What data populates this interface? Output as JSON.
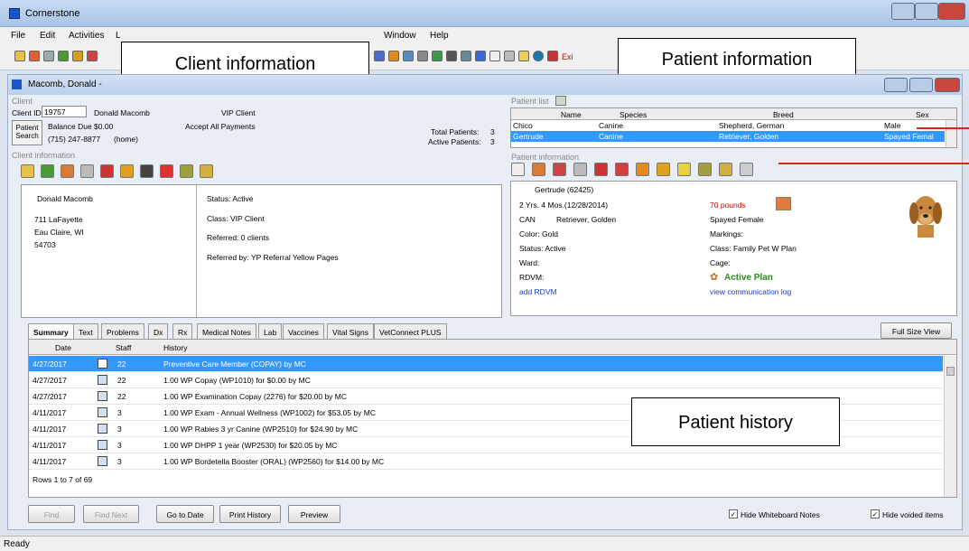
{
  "window": {
    "title": "Cornerstone",
    "status": "Ready"
  },
  "menu": [
    "File",
    "Edit",
    "Activities",
    "L",
    "Window",
    "Help"
  ],
  "toolbar": {
    "exit_label": "Exi"
  },
  "callouts": {
    "client": "Client information",
    "patient": "Patient information",
    "history": "Patient history"
  },
  "child": {
    "title": "Macomb, Donald -"
  },
  "client": {
    "section": "Client",
    "id_label": "Client ID:",
    "id_value": "19757",
    "name": "Donald Macomb",
    "vip": "VIP Client",
    "balance": "Balance Due  $0.00",
    "payments": "Accept All Payments",
    "search_line1": "Patient",
    "search_line2": "Search",
    "phone": "(715) 247-8877",
    "phone_type": "(home)",
    "total_label": "Total Patients:",
    "total_value": "3",
    "active_label": "Active Patients:",
    "active_value": "3",
    "info_section": "Client information",
    "name2": "Donald Macomb",
    "addr1": "711 LaFayette",
    "addr2": "Eau Claire, WI",
    "zip": "54703",
    "status": "Status:  Active",
    "class": "Class:   VIP Client",
    "referred": "Referred:   0 clients",
    "referred_by": "Referred by: YP  Referral Yellow Pages"
  },
  "patient_list": {
    "section": "Patient list",
    "headers": [
      "Name",
      "Species",
      "Breed",
      "Sex"
    ],
    "rows": [
      [
        "Chico",
        "Canine",
        "Shepherd, German",
        "Male"
      ],
      [
        "Gertrude",
        "Canine",
        "Retriever, Golden",
        "Spayed Femal"
      ]
    ]
  },
  "patient": {
    "section": "Patient information",
    "name": "Gertrude  (62425)",
    "age": "2 Yrs. 4 Mos.(12/28/2014)",
    "weight": "70 pounds",
    "species": "CAN",
    "breed": "Retriever, Golden",
    "sex": "Spayed Female",
    "color": "Color:  Gold",
    "markings": "Markings:",
    "status": "Status:  Active",
    "class": "Class:  Family Pet W Plan",
    "ward": "Ward:",
    "cage": "Cage:",
    "rdvm": "RDVM:",
    "plan": "Active Plan",
    "add_rdvm": "add RDVM",
    "comm_log": "view communication log"
  },
  "tabs": [
    "Summary",
    "Text",
    "Problems",
    "Dx",
    "Rx",
    "Medical Notes",
    "Lab",
    "Vaccines",
    "Vital Signs",
    "VetConnect PLUS"
  ],
  "full_size": "Full Size View",
  "history": {
    "headers": [
      "Date",
      "Staff",
      "History"
    ],
    "rows": [
      [
        "4/27/2017",
        "22",
        "Preventive Care Member (COPAY) by MC"
      ],
      [
        "4/27/2017",
        "22",
        "1.00 WP Copay (WP1010) for $0.00 by MC"
      ],
      [
        "4/27/2017",
        "22",
        "1.00 WP Examination Copay (2276) for $20.00 by MC"
      ],
      [
        "4/11/2017",
        "3",
        "1.00 WP Exam - Annual Wellness (WP1002) for $53.05 by MC"
      ],
      [
        "4/11/2017",
        "3",
        "1.00 WP Rabies 3 yr Canine (WP2510) for $24.90 by MC"
      ],
      [
        "4/11/2017",
        "3",
        "1.00 WP DHPP 1 year (WP2530) for $20.05 by MC"
      ],
      [
        "4/11/2017",
        "3",
        "1.00 WP Bordetella Booster  (ORAL) (WP2560) for $14.00 by MC"
      ]
    ],
    "rows_label": "Rows 1 to 7 of 69"
  },
  "buttons": {
    "find": "Find",
    "find_next": "Find Next",
    "go_to_date": "Go to Date",
    "print_history": "Print History",
    "preview": "Preview"
  },
  "checks": {
    "whiteboard": "Hide Whiteboard Notes",
    "voided": "Hide voided items"
  }
}
